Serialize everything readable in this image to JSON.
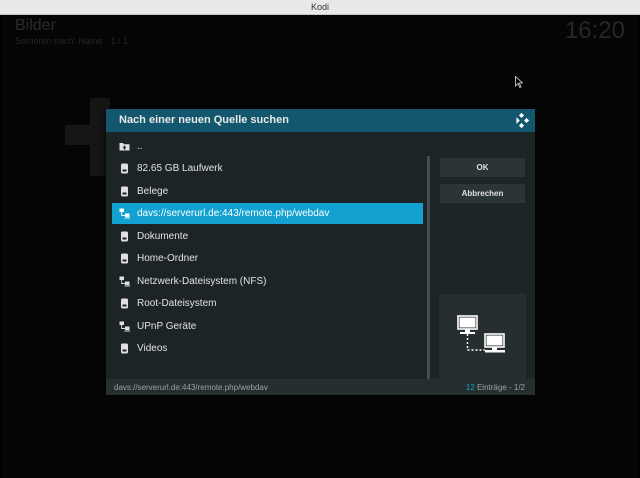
{
  "window": {
    "title": "Kodi"
  },
  "background": {
    "section_title": "Bilder",
    "section_subtitle": "Sortieren nach: Name  ·  1 / 1",
    "clock": "16:20"
  },
  "dialog": {
    "title": "Nach einer neuen Quelle suchen",
    "items": [
      {
        "label": "..",
        "icon": "folder-up-icon",
        "selected": false
      },
      {
        "label": "82.65 GB Laufwerk",
        "icon": "drive-icon",
        "selected": false
      },
      {
        "label": "Belege",
        "icon": "drive-icon",
        "selected": false
      },
      {
        "label": "davs://serverurl.de:443/remote.php/webdav",
        "icon": "network-icon",
        "selected": true
      },
      {
        "label": "Dokumente",
        "icon": "drive-icon",
        "selected": false
      },
      {
        "label": "Home-Ordner",
        "icon": "drive-icon",
        "selected": false
      },
      {
        "label": "Netzwerk-Dateisystem (NFS)",
        "icon": "network-icon",
        "selected": false
      },
      {
        "label": "Root-Dateisystem",
        "icon": "drive-icon",
        "selected": false
      },
      {
        "label": "UPnP Geräte",
        "icon": "network-icon",
        "selected": false
      },
      {
        "label": "Videos",
        "icon": "drive-icon",
        "selected": false
      }
    ],
    "ok_label": "OK",
    "cancel_label": "Abbrechen",
    "preview_icon": "network-computers-icon",
    "footer": {
      "path": "davs://serverurl.de:443/remote.php/webdav",
      "count": "12",
      "count_suffix": " Einträge - 1/2"
    }
  },
  "colors": {
    "accent": "#12a1d0",
    "header": "#12576e",
    "panel": "#1d2426"
  }
}
